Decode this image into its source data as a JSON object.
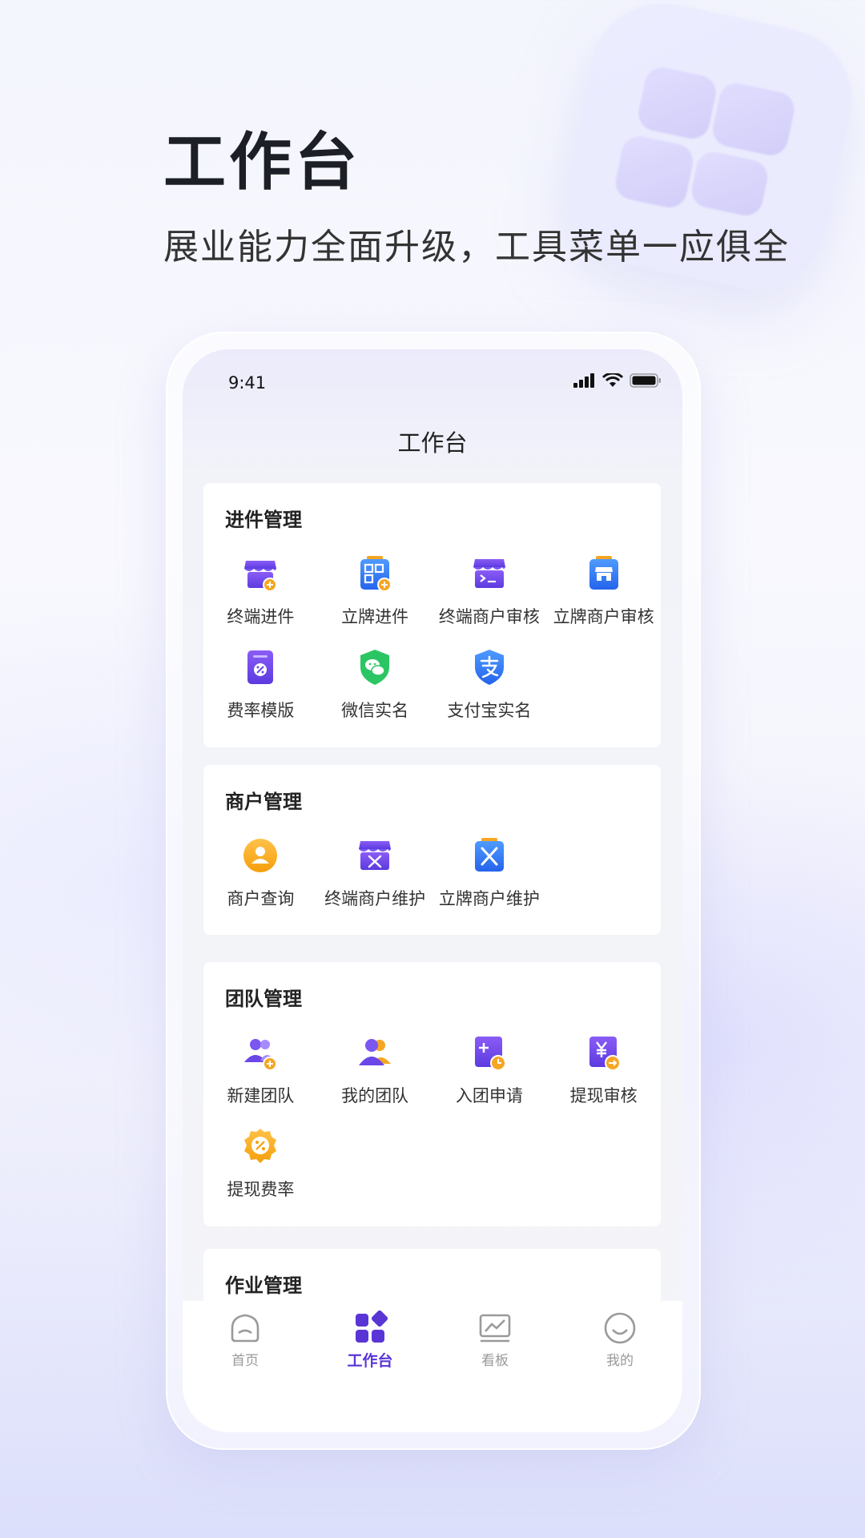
{
  "hero": {
    "title": "工作台",
    "subtitle": "展业能力全面升级，工具菜单一应俱全"
  },
  "status_bar": {
    "time": "9:41"
  },
  "nav": {
    "title": "工作台"
  },
  "sections": [
    {
      "title": "进件管理",
      "items": [
        {
          "label": "终端进件",
          "icon": "store-add-icon"
        },
        {
          "label": "立牌进件",
          "icon": "qr-add-icon"
        },
        {
          "label": "终端商户审核",
          "icon": "store-terminal-icon"
        },
        {
          "label": "立牌商户审核",
          "icon": "clipboard-store-icon"
        },
        {
          "label": "费率模版",
          "icon": "rate-template-icon"
        },
        {
          "label": "微信实名",
          "icon": "wechat-shield-icon"
        },
        {
          "label": "支付宝实名",
          "icon": "alipay-shield-icon"
        }
      ]
    },
    {
      "title": "商户管理",
      "items": [
        {
          "label": "商户查询",
          "icon": "merchant-user-icon"
        },
        {
          "label": "终端商户维护",
          "icon": "store-tools-icon"
        },
        {
          "label": "立牌商户维护",
          "icon": "clipboard-tools-icon"
        }
      ]
    },
    {
      "title": "团队管理",
      "items": [
        {
          "label": "新建团队",
          "icon": "team-add-icon"
        },
        {
          "label": "我的团队",
          "icon": "team-icon"
        },
        {
          "label": "入团申请",
          "icon": "join-apply-icon"
        },
        {
          "label": "提现审核",
          "icon": "withdraw-review-icon"
        },
        {
          "label": "提现费率",
          "icon": "withdraw-rate-icon"
        }
      ]
    },
    {
      "title": "作业管理",
      "items": []
    }
  ],
  "tabbar": {
    "items": [
      {
        "label": "首页",
        "icon": "home-icon",
        "active": false
      },
      {
        "label": "工作台",
        "icon": "workbench-icon",
        "active": true
      },
      {
        "label": "看板",
        "icon": "dashboard-icon",
        "active": false
      },
      {
        "label": "我的",
        "icon": "profile-icon",
        "active": false
      }
    ]
  },
  "colors": {
    "accent": "#5a35d6",
    "orange": "#f5a623",
    "blue": "#2f7cf6",
    "green": "#2bc663"
  }
}
